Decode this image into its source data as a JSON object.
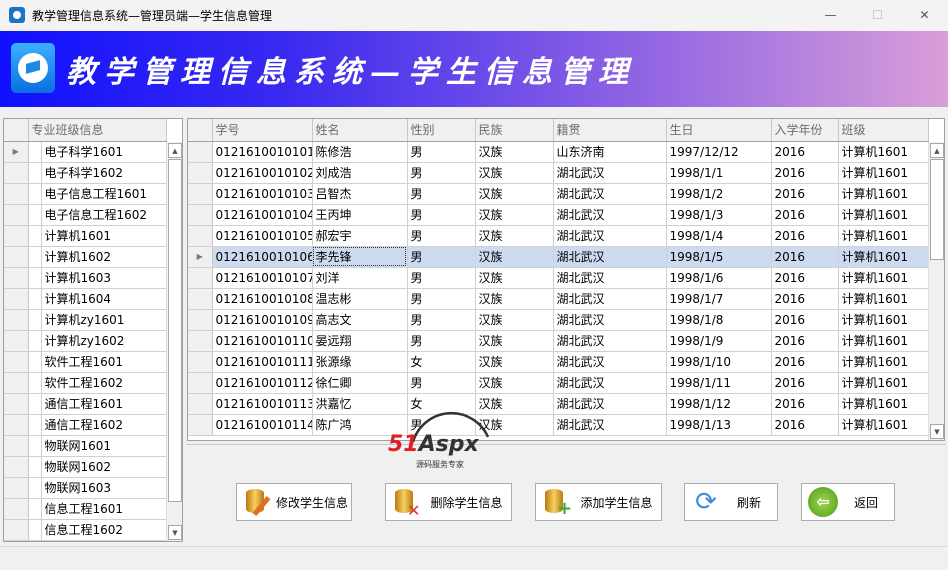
{
  "window": {
    "title": "教学管理信息系统—管理员端—学生信息管理",
    "minimize": "—",
    "maximize": "☐",
    "close": "✕"
  },
  "banner": {
    "title": "教学管理信息系统—学生信息管理"
  },
  "class_grid": {
    "header": "专业班级信息",
    "items": [
      "电子科学1601",
      "电子科学1602",
      "电子信息工程1601",
      "电子信息工程1602",
      "计算机1601",
      "计算机1602",
      "计算机1603",
      "计算机1604",
      "计算机zy1601",
      "计算机zy1602",
      "软件工程1601",
      "软件工程1602",
      "通信工程1601",
      "通信工程1602",
      "物联网1601",
      "物联网1602",
      "物联网1603",
      "信息工程1601",
      "信息工程1602"
    ],
    "current_index": 0
  },
  "student_grid": {
    "columns": [
      "学号",
      "姓名",
      "性别",
      "民族",
      "籍贯",
      "生日",
      "入学年份",
      "班级"
    ],
    "selected_index": 5,
    "rows": [
      [
        "0121610010101",
        "陈修浩",
        "男",
        "汉族",
        "山东济南",
        "1997/12/12",
        "2016",
        "计算机1601"
      ],
      [
        "0121610010102",
        "刘成浩",
        "男",
        "汉族",
        "湖北武汉",
        "1998/1/1",
        "2016",
        "计算机1601"
      ],
      [
        "0121610010103",
        "吕智杰",
        "男",
        "汉族",
        "湖北武汉",
        "1998/1/2",
        "2016",
        "计算机1601"
      ],
      [
        "0121610010104",
        "王丙坤",
        "男",
        "汉族",
        "湖北武汉",
        "1998/1/3",
        "2016",
        "计算机1601"
      ],
      [
        "0121610010105",
        "郝宏宇",
        "男",
        "汉族",
        "湖北武汉",
        "1998/1/4",
        "2016",
        "计算机1601"
      ],
      [
        "0121610010106",
        "李先锋",
        "男",
        "汉族",
        "湖北武汉",
        "1998/1/5",
        "2016",
        "计算机1601"
      ],
      [
        "0121610010107",
        "刘洋",
        "男",
        "汉族",
        "湖北武汉",
        "1998/1/6",
        "2016",
        "计算机1601"
      ],
      [
        "0121610010108",
        "温志彬",
        "男",
        "汉族",
        "湖北武汉",
        "1998/1/7",
        "2016",
        "计算机1601"
      ],
      [
        "0121610010109",
        "高志文",
        "男",
        "汉族",
        "湖北武汉",
        "1998/1/8",
        "2016",
        "计算机1601"
      ],
      [
        "0121610010110",
        "晏远翔",
        "男",
        "汉族",
        "湖北武汉",
        "1998/1/9",
        "2016",
        "计算机1601"
      ],
      [
        "0121610010111",
        "张源缘",
        "女",
        "汉族",
        "湖北武汉",
        "1998/1/10",
        "2016",
        "计算机1601"
      ],
      [
        "0121610010112",
        "徐仁卿",
        "男",
        "汉族",
        "湖北武汉",
        "1998/1/11",
        "2016",
        "计算机1601"
      ],
      [
        "0121610010113",
        "洪嘉忆",
        "女",
        "汉族",
        "湖北武汉",
        "1998/1/12",
        "2016",
        "计算机1601"
      ],
      [
        "0121610010114",
        "陈广鸿",
        "男",
        "汉族",
        "湖北武汉",
        "1998/1/13",
        "2016",
        "计算机1601"
      ]
    ]
  },
  "buttons": {
    "edit": "修改学生信息",
    "delete": "删除学生信息",
    "add": "添加学生信息",
    "refresh": "刷新",
    "back": "返回"
  },
  "watermark": {
    "brand": "51Aspx",
    "tagline": "源码服务专家"
  }
}
